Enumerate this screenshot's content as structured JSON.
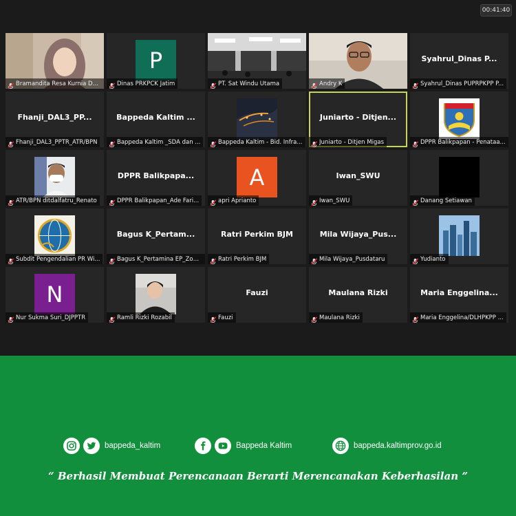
{
  "meeting": {
    "timer": "00:41:40",
    "participants": [
      {
        "tile_title": "",
        "name": "Bramandita Resa Kurnia Dewi",
        "tile": "photo-woman-hijab"
      },
      {
        "tile_title": "",
        "name": "Dinas PRKPCK Jatim",
        "tile": "avatar",
        "initial": "P",
        "color": "#0f6e55"
      },
      {
        "tile_title": "",
        "name": "PT. Sat Windu Utama",
        "tile": "photo-meeting-room"
      },
      {
        "tile_title": "",
        "name": "Andry K",
        "tile": "photo-man-glasses"
      },
      {
        "tile_title": "Syahrul_Dinas P...",
        "name": "Syahrul_Dinas PUPRPKPP P...",
        "tile": "text"
      },
      {
        "tile_title": "Fhanji_DAL3_PP...",
        "name": "Fhanji_DAL3_PPTR_ATR/BPN",
        "tile": "text"
      },
      {
        "tile_title": "Bappeda Kaltim ...",
        "name": "Bappeda Kaltim _SDA dan ...",
        "tile": "text"
      },
      {
        "tile_title": "",
        "name": "Bappeda Kaltim - Bid. Infra...",
        "tile": "photo-night-city"
      },
      {
        "tile_title": "Juniarto - Ditjen...",
        "name": "Juniarto - Ditjen Migas",
        "tile": "text",
        "active": true
      },
      {
        "tile_title": "",
        "name": "DPPR Balikpapan - Penataa...",
        "tile": "logo-balikpapan"
      },
      {
        "tile_title": "",
        "name": "ATR/BPN ditdalfatru_Renato",
        "tile": "photo-man-mask"
      },
      {
        "tile_title": "DPPR Balikpapa...",
        "name": "DPPR Balikpapan_Ade Fari...",
        "tile": "text"
      },
      {
        "tile_title": "",
        "name": "apri Aprianto",
        "tile": "avatar",
        "initial": "A",
        "color": "#e8531f"
      },
      {
        "tile_title": "Iwan_SWU",
        "name": "Iwan_SWU",
        "tile": "text"
      },
      {
        "tile_title": "",
        "name": "Danang Setiawan",
        "tile": "black"
      },
      {
        "tile_title": "",
        "name": "Subdit Pengendalian PR Wi...",
        "tile": "logo-atr"
      },
      {
        "tile_title": "Bagus K_Pertam...",
        "name": "Bagus K_Pertamina EP_Zon...",
        "tile": "text"
      },
      {
        "tile_title": "Ratri Perkim BJM",
        "name": "Ratri Perkim BJM",
        "tile": "text"
      },
      {
        "tile_title": "Mila Wijaya_Pus...",
        "name": "Mila Wijaya_Pusdataru",
        "tile": "text"
      },
      {
        "tile_title": "",
        "name": "Yudianto",
        "tile": "photo-skyline"
      },
      {
        "tile_title": "",
        "name": "Nur Sukma Suri_DJPPTR",
        "tile": "avatar",
        "initial": "N",
        "color": "#7a1f8f"
      },
      {
        "tile_title": "",
        "name": "Ramli Rizki Rozabil",
        "tile": "photo-man-laptop"
      },
      {
        "tile_title": "Fauzi",
        "name": "Fauzi",
        "tile": "text"
      },
      {
        "tile_title": "Maulana Rizki",
        "name": "Maulana Rizki",
        "tile": "text"
      },
      {
        "tile_title": "Maria Enggelina...",
        "name": "Maria Enggelina/DLHPKPP ...",
        "tile": "text"
      }
    ]
  },
  "footer": {
    "social_1": "bappeda_kaltim",
    "social_2": "Bappeda Kaltim",
    "website": "bappeda.kaltimprov.go.id",
    "tagline": "“ Berhasil  Membuat Perencanaan Berarti Merencanakan Keberhasilan ”",
    "background": "#128f3c"
  }
}
